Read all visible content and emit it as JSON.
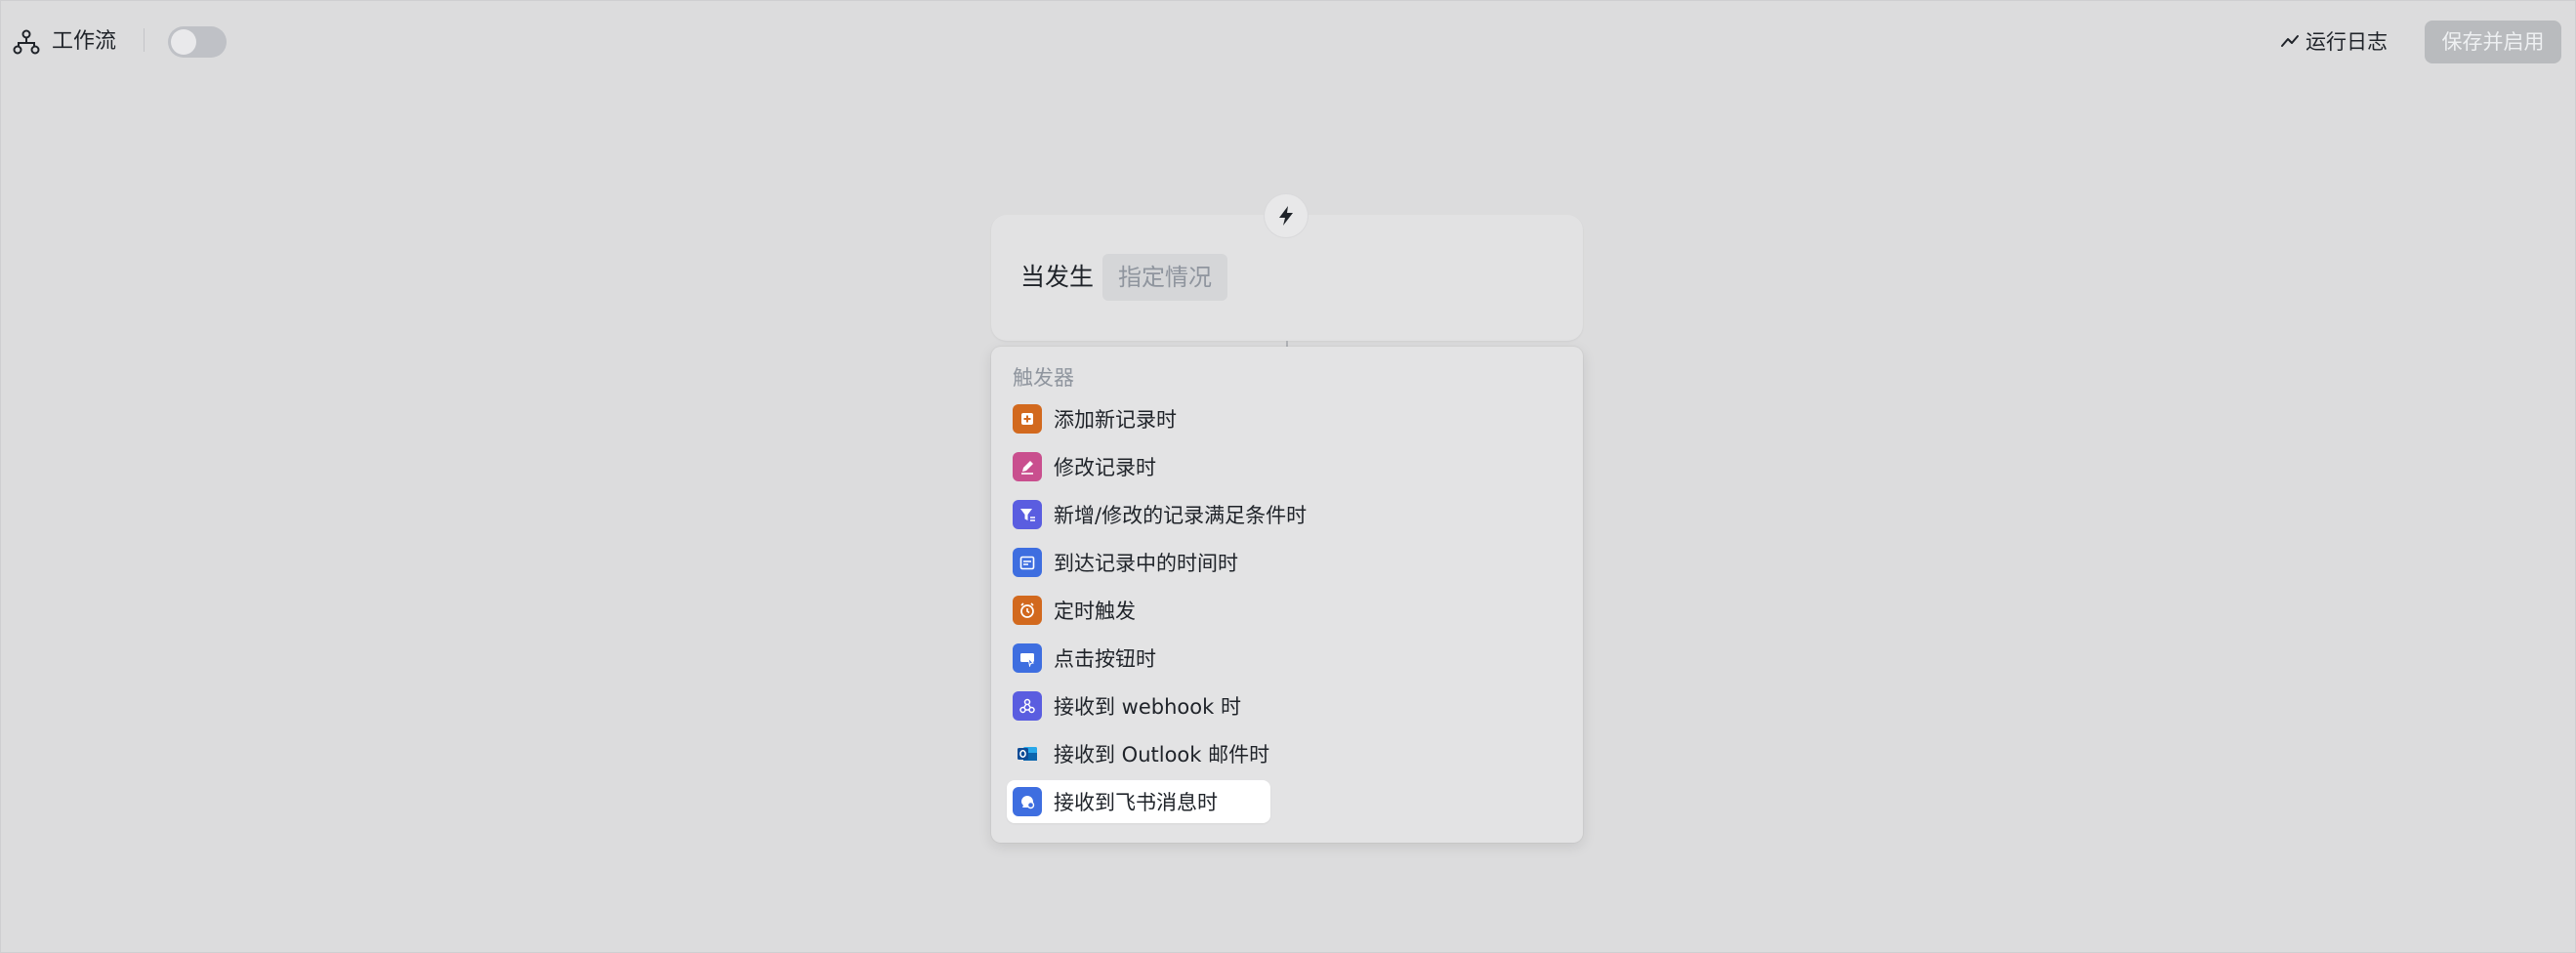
{
  "topbar": {
    "title": "工作流",
    "workflow_icon": "workflow-icon",
    "toggle_state": "off",
    "run_log_label": "运行日志",
    "save_button_label": "保存并启用"
  },
  "trigger_node": {
    "prefix": "当发生",
    "placeholder_chip": "指定情况",
    "icon": "lightning-icon"
  },
  "menu": {
    "header": "触发器",
    "items": [
      {
        "label": "添加新记录时",
        "icon": "add-record-icon",
        "color": "#d2691e"
      },
      {
        "label": "修改记录时",
        "icon": "edit-record-icon",
        "color": "#c94f8e"
      },
      {
        "label": "新增/修改的记录满足条件时",
        "icon": "filter-condition-icon",
        "color": "#5a5de0"
      },
      {
        "label": "到达记录中的时间时",
        "icon": "calendar-icon",
        "color": "#3e6ee0"
      },
      {
        "label": "定时触发",
        "icon": "alarm-clock-icon",
        "color": "#d2691e"
      },
      {
        "label": "点击按钮时",
        "icon": "button-click-icon",
        "color": "#3e6ee0"
      },
      {
        "label": "接收到 webhook 时",
        "icon": "webhook-icon",
        "color": "#5a5de0"
      },
      {
        "label": "接收到 Outlook 邮件时",
        "icon": "outlook-icon",
        "color": "#2a72c8"
      },
      {
        "label": "接收到飞书消息时",
        "icon": "feishu-message-icon",
        "color": "#3e6ee0"
      }
    ]
  },
  "colors": {
    "canvas": "#dcdcdd",
    "text": "#1f2329",
    "muted": "#8f959e",
    "disabled_button": "#b9bbbe"
  }
}
